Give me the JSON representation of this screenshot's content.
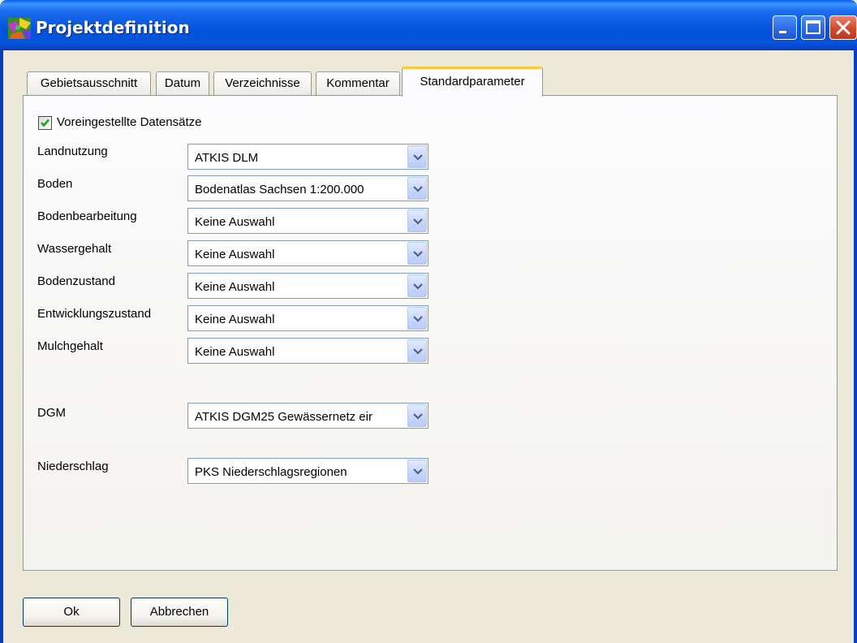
{
  "window": {
    "title": "Projektdefinition",
    "icon": "app-icon",
    "controls": [
      "minimize-icon",
      "maximize-icon",
      "close-icon"
    ]
  },
  "tabs": [
    {
      "label": "Gebietsausschnitt",
      "active": false
    },
    {
      "label": "Datum",
      "active": false
    },
    {
      "label": "Verzeichnisse",
      "active": false
    },
    {
      "label": "Kommentar",
      "active": false
    },
    {
      "label": "Standardparameter",
      "active": true
    }
  ],
  "preset_checkbox": {
    "label": "Voreingestellte Datensätze",
    "checked": true
  },
  "fields": [
    {
      "label": "Landnutzung",
      "value": "ATKIS DLM"
    },
    {
      "label": "Boden",
      "value": "Bodenatlas Sachsen 1:200.000"
    },
    {
      "label": "Bodenbearbeitung",
      "value": "Keine Auswahl"
    },
    {
      "label": "Wassergehalt",
      "value": "Keine Auswahl"
    },
    {
      "label": "Bodenzustand",
      "value": "Keine Auswahl"
    },
    {
      "label": "Entwicklungszustand",
      "value": "Keine Auswahl"
    },
    {
      "label": "Mulchgehalt",
      "value": "Keine Auswahl"
    },
    {
      "label": "DGM",
      "value": "ATKIS DGM25 Gewässernetz eir"
    },
    {
      "label": "Niederschlag",
      "value": "PKS Niederschlagsregionen"
    }
  ],
  "buttons": {
    "ok": "Ok",
    "cancel": "Abbrechen"
  },
  "colors": {
    "titlebar": "#0255dd",
    "face": "#ece9d8",
    "active_tab_accent": "#ffc83c",
    "checkmark": "#21a121"
  }
}
